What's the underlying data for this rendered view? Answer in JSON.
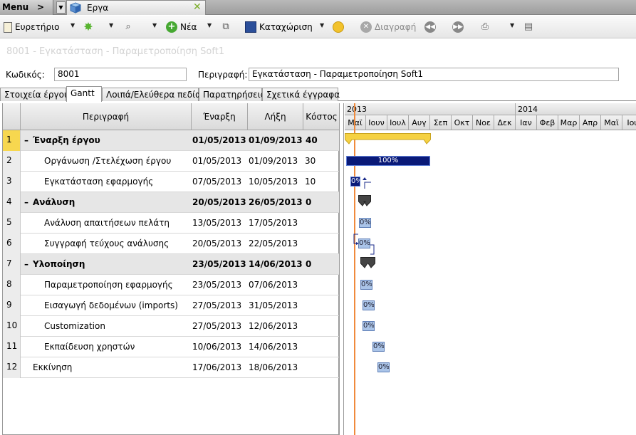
{
  "tabbar": {
    "menu_label": "Menu",
    "document_tab_label": "Εργα"
  },
  "toolbar": {
    "index_label": "Ευρετήριο",
    "new_label": "Νέα",
    "save_label": "Καταχώριση",
    "delete_label": "Διαγραφή"
  },
  "form": {
    "title": "8001 - Εγκατάσταση - Παραμετροποίηση Soft1",
    "code_label": "Κωδικός:",
    "code_value": "8001",
    "description_label": "Περιγραφή:",
    "description_value": "Εγκατάσταση - Παραμετροποίηση Soft1"
  },
  "tabs": [
    "Στοιχεία έργου",
    "Gantt",
    "Λοιπά/Ελεύθερα πεδία",
    "Παρατηρήσεις",
    "Σχετικά έγγραφα"
  ],
  "grid": {
    "columns": [
      "Περιγραφή",
      "Έναρξη",
      "Λήξη",
      "Κόστος"
    ],
    "rows": [
      {
        "num": "1",
        "desc": "Έναρξη έργου",
        "start": "01/05/2013",
        "end": "01/09/2013",
        "cost": "40",
        "group": true
      },
      {
        "num": "2",
        "desc": "Οργάνωση /Στελέχωση έργου",
        "start": "01/05/2013",
        "end": "01/09/2013",
        "cost": "30",
        "group": false
      },
      {
        "num": "3",
        "desc": "Εγκατάσταση εφαρμογής",
        "start": "07/05/2013",
        "end": "10/05/2013",
        "cost": "10",
        "group": false
      },
      {
        "num": "4",
        "desc": "Ανάλυση",
        "start": "20/05/2013",
        "end": "26/05/2013",
        "cost": "0",
        "group": true
      },
      {
        "num": "5",
        "desc": "Ανάλυση απαιτήσεων πελάτη",
        "start": "13/05/2013",
        "end": "17/05/2013",
        "cost": "",
        "group": false
      },
      {
        "num": "6",
        "desc": "Συγγραφή τεύχους ανάλυσης",
        "start": "20/05/2013",
        "end": "22/05/2013",
        "cost": "",
        "group": false
      },
      {
        "num": "7",
        "desc": "Υλοποίηση",
        "start": "23/05/2013",
        "end": "14/06/2013",
        "cost": "0",
        "group": true
      },
      {
        "num": "8",
        "desc": "Παραμετροποίηση εφαρμογής",
        "start": "23/05/2013",
        "end": "07/06/2013",
        "cost": "",
        "group": false
      },
      {
        "num": "9",
        "desc": "Εισαγωγή δεδομένων (imports)",
        "start": "27/05/2013",
        "end": "31/05/2013",
        "cost": "",
        "group": false
      },
      {
        "num": "10",
        "desc": "Customization",
        "start": "27/05/2013",
        "end": "12/06/2013",
        "cost": "",
        "group": false
      },
      {
        "num": "11",
        "desc": "Εκπαίδευση χρηστών",
        "start": "10/06/2013",
        "end": "14/06/2013",
        "cost": "",
        "group": false
      },
      {
        "num": "12",
        "desc": "Εκκίνηση",
        "start": "17/06/2013",
        "end": "18/06/2013",
        "cost": "",
        "group": false,
        "top": true
      }
    ]
  },
  "gantt": {
    "years": [
      "2013",
      "2014"
    ],
    "months": [
      "Μαϊ",
      "Ιουν",
      "Ιουλ",
      "Αυγ",
      "Σεπ",
      "Οκτ",
      "Νοε",
      "Δεκ",
      "Ιαν",
      "Φεβ",
      "Μαρ",
      "Απρ",
      "Μαϊ",
      "Ιου"
    ],
    "bar_labels": [
      "100%",
      "0%",
      "0%",
      "0%",
      "0%",
      "0%",
      "0%",
      "0%",
      "0%"
    ],
    "colors": {
      "summary_bar": "#f5d142",
      "progress_bar": "#0a1a78",
      "task_bar": "#aac4e8",
      "today_line": "#f08a3c",
      "selected_row": "#f7d74f"
    }
  }
}
